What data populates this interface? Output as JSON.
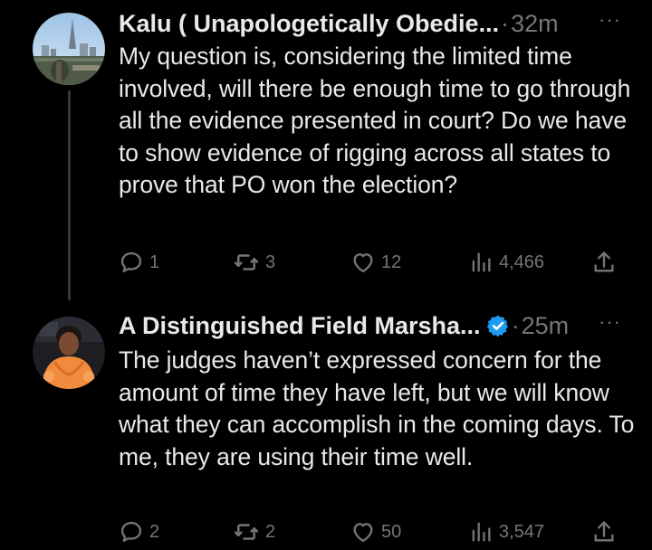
{
  "tweets": [
    {
      "display_name": "Kalu ( Unapologetically Obedie...",
      "separator": "·",
      "timestamp": "32m",
      "more": "···",
      "text": "My question is, considering the limited time involved, will there be enough time to go through all the evidence presented in court? Do we have to show evidence of rigging across all states to prove that PO won the election?",
      "avatar": "avatar-city-skyline-icon",
      "actions": {
        "replies": "1",
        "reposts": "3",
        "likes": "12",
        "views": "4,466"
      }
    },
    {
      "display_name": "A Distinguished Field Marsha...",
      "verified": true,
      "separator": "·",
      "timestamp": "25m",
      "more": "···",
      "text": "The judges haven’t expressed concern for the amount of time they have left, but we will know what they can accomplish in the coming days. To me, they are using their time well.",
      "avatar": "avatar-person-orange-coat-icon",
      "actions": {
        "replies": "2",
        "reposts": "2",
        "likes": "50",
        "views": "3,547"
      }
    }
  ],
  "colors": {
    "background": "#000000",
    "text_primary": "#e7e9ea",
    "text_secondary": "#71767b",
    "verified": "#1d9bf0",
    "thread_line": "#333639"
  }
}
